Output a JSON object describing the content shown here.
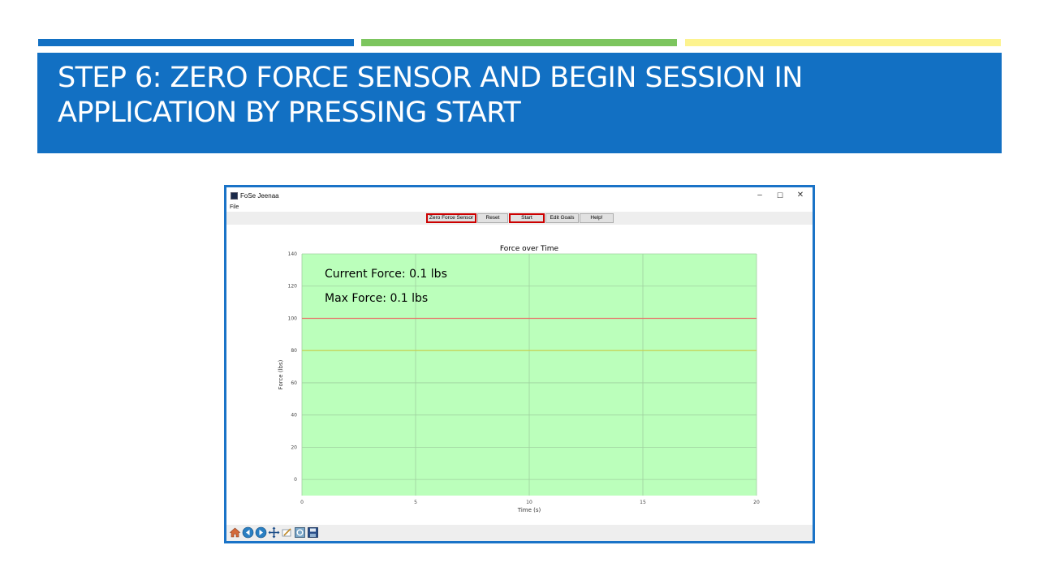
{
  "slide": {
    "title": "STEP 6: ZERO FORCE SENSOR AND BEGIN SESSION IN APPLICATION BY PRESSING START",
    "accent_colors": [
      "#1270c3",
      "#7cc55e",
      "#fdf38f"
    ],
    "banner_color": "#1270c3"
  },
  "app": {
    "window_title": "FoSe Jeenaa",
    "window_controls": [
      "–",
      "☐",
      "✕"
    ],
    "menu": {
      "file": "File"
    },
    "toolbar": {
      "zero_label": "Zero Force Sensor",
      "reset_label": "Reset",
      "start_label": "Start",
      "edit_goals_label": "Edit Goals",
      "help_label": "Help!",
      "highlighted": [
        "Zero Force Sensor",
        "Start"
      ],
      "highlight_color": "#cc0000"
    },
    "nav_icons": [
      "home-icon",
      "back-icon",
      "forward-icon",
      "pan-icon",
      "zoom-icon",
      "configure-icon",
      "save-icon"
    ]
  },
  "chart_data": {
    "type": "line",
    "title": "Force over Time",
    "xlabel": "Time (s)",
    "ylabel": "Force (lbs)",
    "xlim": [
      0,
      20
    ],
    "ylim": [
      -10,
      140
    ],
    "xticks": [
      0,
      5,
      10,
      15,
      20
    ],
    "yticks": [
      0,
      20,
      40,
      60,
      80,
      100,
      120,
      140
    ],
    "grid": true,
    "background_color": "#bbffbb",
    "reference_lines": [
      {
        "y": 100,
        "color": "#e8736a"
      },
      {
        "y": 80,
        "color": "#c9d24a"
      }
    ],
    "annotations": [
      {
        "text": "Current Force: 0.1 lbs"
      },
      {
        "text": "Max Force: 0.1 lbs"
      }
    ]
  }
}
